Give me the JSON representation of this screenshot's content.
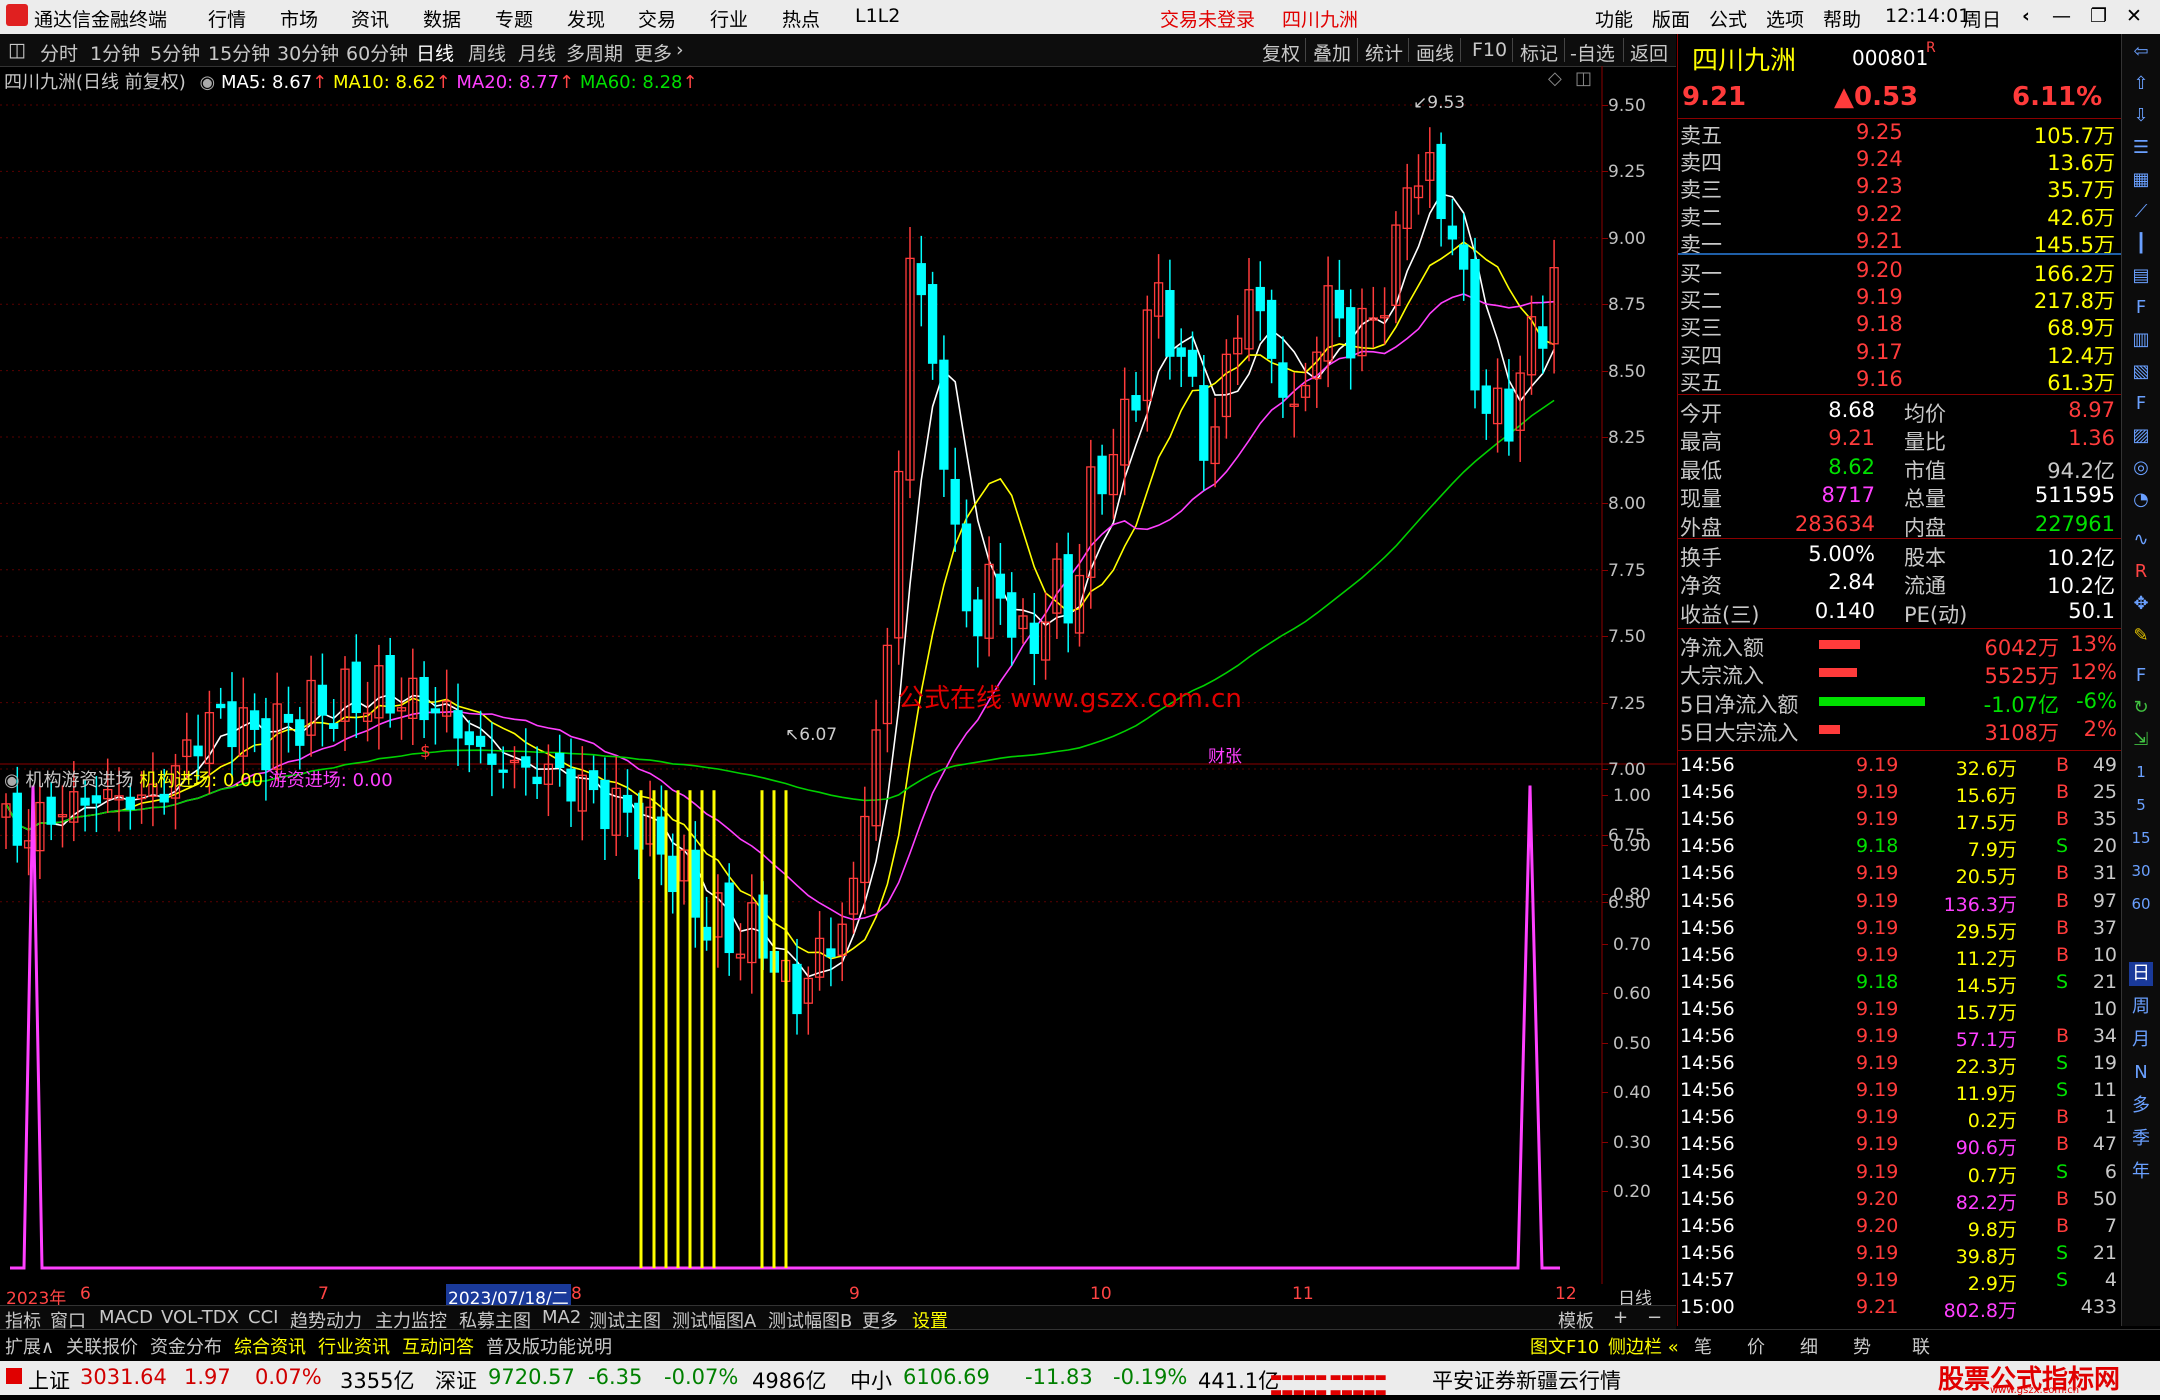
{
  "titlebar": {
    "app_name": "通达信金融终端",
    "menus": [
      "行情",
      "市场",
      "资讯",
      "数据",
      "专题",
      "发现",
      "交易",
      "行业",
      "热点",
      "L1L2"
    ],
    "login_status": "交易未登录",
    "stock_name": "四川九洲",
    "right_menus": [
      "功能",
      "版面",
      "公式",
      "选项",
      "帮助"
    ],
    "time": "12:14:01",
    "weekday": "周日"
  },
  "periodbar": {
    "periods": [
      "分时",
      "1分钟",
      "5分钟",
      "15分钟",
      "30分钟",
      "60分钟",
      "日线",
      "周线",
      "月线",
      "多周期",
      "更多"
    ],
    "active": "日线",
    "tools": [
      "复权",
      "叠加",
      "统计",
      "画线",
      "F10",
      "标记",
      "-自选",
      "返回"
    ]
  },
  "main_chart": {
    "legend_title": "四川九洲(日线 前复权)",
    "ma5": "MA5: 8.67",
    "ma10": "MA10: 8.62",
    "ma20": "MA20: 8.77",
    "ma60": "MA60: 8.28",
    "price_labels": [
      "9.50",
      "9.25",
      "9.00",
      "8.75",
      "8.50",
      "8.25",
      "8.00",
      "7.75",
      "7.50",
      "7.25",
      "7.00",
      "6.75",
      "6.50"
    ],
    "high_mark": "9.53",
    "low_mark": "6.07",
    "watermark": "公式在线  www.gszx.com.cn",
    "event_marks": [
      "$",
      "财张"
    ]
  },
  "indicator": {
    "name": "机构游资进场",
    "line1": "机构进场: 0.00",
    "line2": "游资进场: 0.00",
    "labels": [
      "1.00",
      "0.90",
      "0.80",
      "0.70",
      "0.60",
      "0.50",
      "0.40",
      "0.30",
      "0.20"
    ]
  },
  "xaxis": {
    "labels": [
      "2023年",
      "6",
      "7",
      "2023/07/18/二",
      "8",
      "9",
      "10",
      "11",
      "12"
    ],
    "period": "日线"
  },
  "tabbar": [
    "指标",
    "窗口",
    "MACD",
    "VOL-TDX",
    "CCI",
    "趋势动力",
    "主力监控",
    "私募主图",
    "MA2",
    "测试主图",
    "测试幅图A",
    "测试幅图B",
    "更多",
    "设置"
  ],
  "tabbar_right": [
    "模板",
    "+",
    "−"
  ],
  "extbar": [
    "扩展∧",
    "关联报价",
    "资金分布",
    "综合资讯",
    "行业资讯",
    "互动问答",
    "普及版功能说明"
  ],
  "extbar_right": [
    "图文F10",
    "侧边栏 «",
    "笔",
    "价",
    "细",
    "势",
    "联"
  ],
  "statusbar": {
    "sh_name": "上证",
    "sh_val": "3031.64",
    "sh_chg": "1.97",
    "sh_pct": "0.07%",
    "sh_amt": "3355亿",
    "sz_name": "深证",
    "sz_val": "9720.57",
    "sz_chg": "-6.35",
    "sz_pct": "-0.07%",
    "sz_amt": "4986亿",
    "zx_name": "中小",
    "zx_val": "6106.69",
    "zx_chg": "-11.83",
    "zx_pct": "-0.19%",
    "zx_amt": "441.1亿",
    "broker": "平安证券新疆云行情",
    "logo_text": "股票公式指标网",
    "logo_url": "www.gszx.com.cn"
  },
  "quote": {
    "name": "四川九洲",
    "code": "000801",
    "flag": "R",
    "price": "9.21",
    "change": "▲0.53",
    "pct": "6.11%",
    "asks": [
      {
        "label": "卖五",
        "price": "9.25",
        "vol": "105.7万"
      },
      {
        "label": "卖四",
        "price": "9.24",
        "vol": "13.6万"
      },
      {
        "label": "卖三",
        "price": "9.23",
        "vol": "35.7万"
      },
      {
        "label": "卖二",
        "price": "9.22",
        "vol": "42.6万"
      },
      {
        "label": "卖一",
        "price": "9.21",
        "vol": "145.5万"
      }
    ],
    "bids": [
      {
        "label": "买一",
        "price": "9.20",
        "vol": "166.2万"
      },
      {
        "label": "买二",
        "price": "9.19",
        "vol": "217.8万"
      },
      {
        "label": "买三",
        "price": "9.18",
        "vol": "68.9万"
      },
      {
        "label": "买四",
        "price": "9.17",
        "vol": "12.4万"
      },
      {
        "label": "买五",
        "price": "9.16",
        "vol": "61.3万"
      }
    ],
    "stats": [
      {
        "l1": "今开",
        "v1": "8.68",
        "l2": "均价",
        "v2": "8.97"
      },
      {
        "l1": "最高",
        "v1": "9.21",
        "l2": "量比",
        "v2": "1.36"
      },
      {
        "l1": "最低",
        "v1": "8.62",
        "l2": "市值",
        "v2": "94.2亿"
      },
      {
        "l1": "现量",
        "v1": "8717",
        "l2": "总量",
        "v2": "511595"
      },
      {
        "l1": "外盘",
        "v1": "283634",
        "l2": "内盘",
        "v2": "227961"
      }
    ],
    "stats2": [
      {
        "l1": "换手",
        "v1": "5.00%",
        "l2": "股本",
        "v2": "10.2亿"
      },
      {
        "l1": "净资",
        "v1": "2.84",
        "l2": "流通",
        "v2": "10.2亿"
      },
      {
        "l1": "收益(三)",
        "v1": "0.140",
        "l2": "PE(动)",
        "v2": "50.1"
      }
    ],
    "flows": [
      {
        "label": "净流入额",
        "value": "6042万",
        "pct": "13%",
        "bar": 0.35,
        "color": "#ff3b3b"
      },
      {
        "label": "大宗流入",
        "value": "5525万",
        "pct": "12%",
        "bar": 0.32,
        "color": "#ff3b3b"
      },
      {
        "label": "5日净流入额",
        "value": "-1.07亿",
        "pct": "-6%",
        "bar": 0.9,
        "color": "#00e000"
      },
      {
        "label": "5日大宗流入",
        "value": "3108万",
        "pct": "2%",
        "bar": 0.18,
        "color": "#ff3b3b"
      }
    ],
    "ticks": [
      {
        "t": "14:56",
        "p": "9.19",
        "v": "32.6万",
        "s": "B",
        "n": "49"
      },
      {
        "t": "14:56",
        "p": "9.19",
        "v": "15.6万",
        "s": "B",
        "n": "25"
      },
      {
        "t": "14:56",
        "p": "9.19",
        "v": "17.5万",
        "s": "B",
        "n": "35"
      },
      {
        "t": "14:56",
        "p": "9.18",
        "v": "7.9万",
        "s": "S",
        "n": "20"
      },
      {
        "t": "14:56",
        "p": "9.19",
        "v": "20.5万",
        "s": "B",
        "n": "31"
      },
      {
        "t": "14:56",
        "p": "9.19",
        "v": "136.3万",
        "s": "B",
        "n": "97"
      },
      {
        "t": "14:56",
        "p": "9.19",
        "v": "29.5万",
        "s": "B",
        "n": "37"
      },
      {
        "t": "14:56",
        "p": "9.19",
        "v": "11.2万",
        "s": "B",
        "n": "10"
      },
      {
        "t": "14:56",
        "p": "9.18",
        "v": "14.5万",
        "s": "S",
        "n": "21"
      },
      {
        "t": "14:56",
        "p": "9.19",
        "v": "15.7万",
        "s": "",
        "n": "10"
      },
      {
        "t": "14:56",
        "p": "9.19",
        "v": "57.1万",
        "s": "B",
        "n": "34"
      },
      {
        "t": "14:56",
        "p": "9.19",
        "v": "22.3万",
        "s": "S",
        "n": "19"
      },
      {
        "t": "14:56",
        "p": "9.19",
        "v": "11.9万",
        "s": "S",
        "n": "11"
      },
      {
        "t": "14:56",
        "p": "9.19",
        "v": "0.2万",
        "s": "B",
        "n": "1"
      },
      {
        "t": "14:56",
        "p": "9.19",
        "v": "90.6万",
        "s": "B",
        "n": "47"
      },
      {
        "t": "14:56",
        "p": "9.19",
        "v": "0.7万",
        "s": "S",
        "n": "6"
      },
      {
        "t": "14:56",
        "p": "9.20",
        "v": "82.2万",
        "s": "B",
        "n": "50"
      },
      {
        "t": "14:56",
        "p": "9.20",
        "v": "9.8万",
        "s": "B",
        "n": "7"
      },
      {
        "t": "14:56",
        "p": "9.19",
        "v": "39.8万",
        "s": "S",
        "n": "21"
      },
      {
        "t": "14:57",
        "p": "9.19",
        "v": "2.9万",
        "s": "S",
        "n": "4"
      },
      {
        "t": "15:00",
        "p": "9.21",
        "v": "802.8万",
        "s": "",
        "n": "433"
      }
    ],
    "side_tabs": [
      "日",
      "周",
      "月",
      "N",
      "多",
      "季",
      "年"
    ],
    "side_nums": [
      "1",
      "5",
      "15",
      "30",
      "60"
    ]
  },
  "colors": {
    "up": "#ff3b3b",
    "down": "#00ffff",
    "ma5": "#ffffff",
    "ma10": "#ffff00",
    "ma20": "#ff40ff",
    "ma60": "#00d000"
  }
}
